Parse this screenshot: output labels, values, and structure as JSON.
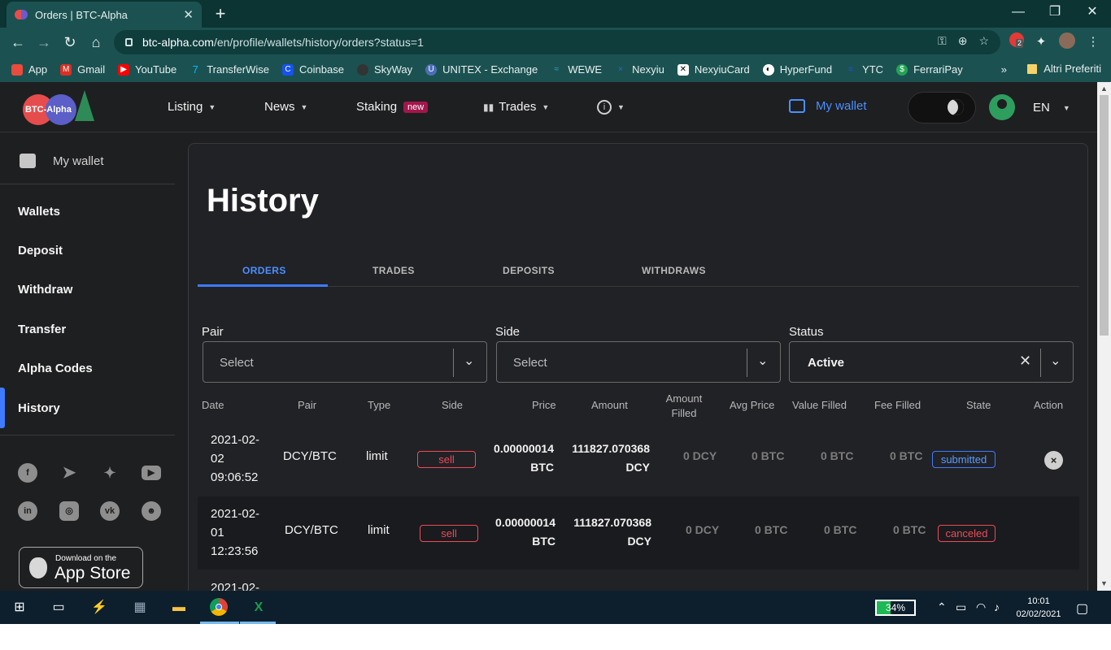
{
  "browser": {
    "tab_title": "Orders | BTC-Alpha",
    "url_host": "btc-alpha.com",
    "url_path": "/en/profile/wallets/history/orders?status=1",
    "extension_badge": "2",
    "bookmarks": [
      {
        "label": "App",
        "icon": "apps-grid-icon",
        "color": "#e94b3c"
      },
      {
        "label": "Gmail",
        "icon": "gmail-icon",
        "color": "#d93025"
      },
      {
        "label": "YouTube",
        "icon": "youtube-icon",
        "color": "#ff0000"
      },
      {
        "label": "TransferWise",
        "icon": "transferwise-icon",
        "color": "#00b9ff"
      },
      {
        "label": "Coinbase",
        "icon": "coinbase-icon",
        "color": "#1652f0"
      },
      {
        "label": "SkyWay",
        "icon": "skyway-icon",
        "color": "#333333"
      },
      {
        "label": "UNITEX - Exchange",
        "icon": "unitex-icon",
        "color": "#4b6fb5"
      },
      {
        "label": "WEWE",
        "icon": "wewe-icon",
        "color": "#3aa0d8"
      },
      {
        "label": "Nexyiu",
        "icon": "nexyiu-icon",
        "color": "#2a6ad8"
      },
      {
        "label": "NexyiuCard",
        "icon": "nexyiucard-icon",
        "color": "#ffffff"
      },
      {
        "label": "HyperFund",
        "icon": "hyperfund-icon",
        "color": "#ffffff"
      },
      {
        "label": "YTC",
        "icon": "ytc-icon",
        "color": "#2a4bd8"
      },
      {
        "label": "FerrariPay",
        "icon": "ferraripay-icon",
        "color": "#23a455"
      }
    ],
    "bookmarks_more": "»",
    "other_bookmarks": "Altri Preferiti"
  },
  "site": {
    "logo_text": "BTC-Alpha",
    "nav": {
      "listing": "Listing",
      "news": "News",
      "staking": "Staking",
      "staking_badge": "new",
      "trades": "Trades",
      "my_wallet": "My wallet",
      "lang": "EN"
    }
  },
  "sidebar": {
    "title": "My wallet",
    "items": [
      {
        "label": "Wallets"
      },
      {
        "label": "Deposit"
      },
      {
        "label": "Withdraw"
      },
      {
        "label": "Transfer"
      },
      {
        "label": "Alpha Codes"
      },
      {
        "label": "History"
      }
    ],
    "active": "History",
    "socials": [
      "facebook-icon",
      "telegram-icon",
      "twitter-icon",
      "youtube-icon",
      "linkedin-icon",
      "instagram-icon",
      "vk-icon",
      "reddit-icon"
    ],
    "appstore_small": "Download on the",
    "appstore_big": "App Store"
  },
  "main": {
    "title": "History",
    "tabs": [
      "ORDERS",
      "TRADES",
      "DEPOSITS",
      "WITHDRAWS"
    ],
    "active_tab": "ORDERS",
    "filters": {
      "pair": {
        "label": "Pair",
        "value": "Select"
      },
      "side": {
        "label": "Side",
        "value": "Select"
      },
      "status": {
        "label": "Status",
        "value": "Active"
      }
    },
    "columns": [
      "Date",
      "Pair",
      "Type",
      "Side",
      "Price",
      "Amount",
      "Amount Filled",
      "Avg Price",
      "Value Filled",
      "Fee Filled",
      "State",
      "Action"
    ],
    "rows": [
      {
        "date1": "2021-02-",
        "date2": "02",
        "date3": "09:06:52",
        "pair": "DCY/BTC",
        "type": "limit",
        "side": "sell",
        "price1": "0.00000014",
        "price2": "BTC",
        "amount1": "111827.070368",
        "amount2": "DCY",
        "amount_filled": "0 DCY",
        "avg_price": "0 BTC",
        "value_filled": "0 BTC",
        "fee_filled": "0 BTC",
        "state": "submitted",
        "action": "×"
      },
      {
        "date1": "2021-02-",
        "date2": "01",
        "date3": "12:23:56",
        "pair": "DCY/BTC",
        "type": "limit",
        "side": "sell",
        "price1": "0.00000014",
        "price2": "BTC",
        "amount1": "111827.070368",
        "amount2": "DCY",
        "amount_filled": "0 DCY",
        "avg_price": "0 BTC",
        "value_filled": "0 BTC",
        "fee_filled": "0 BTC",
        "state": "canceled",
        "action": ""
      },
      {
        "date1": "2021-02-"
      }
    ]
  },
  "taskbar": {
    "battery": "34%",
    "time": "10:01",
    "date": "02/02/2021"
  }
}
